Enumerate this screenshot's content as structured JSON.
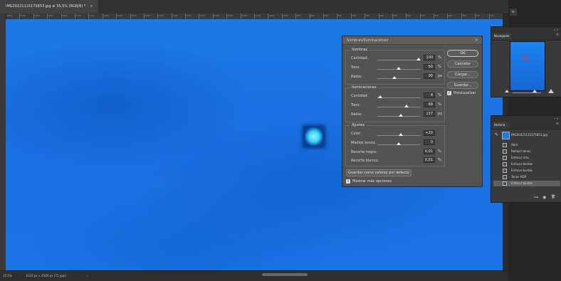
{
  "document": {
    "tab_title": "IMG20221115175853.jpg al 35,5% (RGB/8) *",
    "close_glyph": "×"
  },
  "ruler": {
    "ticks": [
      "2000",
      "1950",
      "1900",
      "1850",
      "1800",
      "1750",
      "1700",
      "1650",
      "1600",
      "1550",
      "1500",
      "1450",
      "1400",
      "1350",
      "1300",
      "1250",
      "1200",
      "1150",
      "1100",
      "1050",
      "1000",
      "950",
      "900",
      "850",
      "800",
      "750",
      "700",
      "650",
      "600",
      "550",
      "500",
      "450",
      "400",
      "350",
      "300",
      "250"
    ]
  },
  "statusbar": {
    "zoom": "35,5%",
    "doc_size": "3120 px × 4160 px (72 ppp)",
    "arrow": "›"
  },
  "dialog": {
    "title": "Sombras/iluminaciones",
    "close_glyph": "×",
    "groups": {
      "shadows": {
        "title": "Sombras",
        "rows": [
          {
            "label": "Cantidad:",
            "value": "100",
            "unit": "%",
            "level": 0.97
          },
          {
            "label": "Tono:",
            "value": "50",
            "unit": "%",
            "level": 0.5
          },
          {
            "label": "Radio:",
            "value": "99",
            "unit": "px",
            "level": 0.4
          }
        ]
      },
      "highlights": {
        "title": "Iluminaciones",
        "rows": [
          {
            "label": "Cantidad:",
            "value": "4",
            "unit": "%",
            "level": 0.06
          },
          {
            "label": "Tono:",
            "value": "69",
            "unit": "%",
            "level": 0.69
          },
          {
            "label": "Radio:",
            "value": "137",
            "unit": "px",
            "level": 0.55
          }
        ]
      },
      "adjustments": {
        "title": "Ajustes",
        "rows": [
          {
            "label": "Color:",
            "value": "+20",
            "unit": "",
            "level": 0.55
          },
          {
            "label": "Medios tonos:",
            "value": "0",
            "unit": "",
            "level": 0.5
          },
          {
            "label": "Recorte negro:",
            "value": "0,01",
            "unit": "%",
            "level": null
          },
          {
            "label": "Recorte blanco:",
            "value": "0,01",
            "unit": "%",
            "level": null
          }
        ]
      }
    },
    "buttons": {
      "ok": "OK",
      "cancel": "Cancelar",
      "load": "Cargar...",
      "save": "Guardar..."
    },
    "preview_label": "Previsualizar",
    "save_default_label": "Guardar como valores por defecto",
    "more_options_label": "Mostrar más opciones",
    "check_glyph": "✓"
  },
  "navigator": {
    "tab_label": "Navegador",
    "top_ctrl": "« ×",
    "menu_glyph": "≡"
  },
  "history": {
    "tab_label": "Historia",
    "top_ctrl": "« ×",
    "menu_glyph": "≡",
    "brush_glyph": "✎",
    "snapshot_name": "IMG20221115175853.jpg",
    "items": [
      "Abrir",
      "Reducir tonos",
      "Enfocar más",
      "Enfocar bordes",
      "Enfocar bordes",
      "Tonos HDR",
      "Enfocar bordes"
    ],
    "selected_index": 6,
    "footer": {
      "a": "⊶",
      "b": "◉",
      "c": "🗑"
    }
  },
  "dock": {
    "glyph": "≡"
  },
  "colors": {
    "canvas_blue": "#1a6fe0",
    "dialog_bg": "#535353",
    "panel_bg": "#3a3a3a"
  }
}
